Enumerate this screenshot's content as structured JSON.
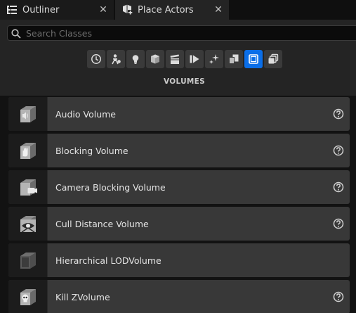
{
  "tabs": [
    {
      "label": "Outliner",
      "icon": "outliner-icon",
      "close": "✕"
    },
    {
      "label": "Place Actors",
      "icon": "place-actors-icon",
      "close": "✕"
    }
  ],
  "search": {
    "placeholder": "Search Classes",
    "value": ""
  },
  "categories": [
    {
      "name": "recently-placed",
      "icon": "clock-icon",
      "active": false
    },
    {
      "name": "basic",
      "icon": "basic-actors-icon",
      "active": false
    },
    {
      "name": "lights",
      "icon": "lightbulb-icon",
      "active": false
    },
    {
      "name": "shapes",
      "icon": "cube-icon",
      "active": false
    },
    {
      "name": "cinematic",
      "icon": "clapper-icon",
      "active": false
    },
    {
      "name": "visual-effects",
      "icon": "play-effects-icon",
      "active": false
    },
    {
      "name": "geometry",
      "icon": "sparkle-icon",
      "active": false
    },
    {
      "name": "volumes-alt",
      "icon": "stacked-cubes-icon",
      "active": false
    },
    {
      "name": "volumes",
      "icon": "volume-icon",
      "active": true
    },
    {
      "name": "all-classes",
      "icon": "all-classes-icon",
      "active": false
    }
  ],
  "section_title": "VOLUMES",
  "items": [
    {
      "label": "Audio Volume",
      "icon": "audio-volume-icon",
      "has_help": true
    },
    {
      "label": "Blocking Volume",
      "icon": "blocking-volume-icon",
      "has_help": true
    },
    {
      "label": "Camera Blocking Volume",
      "icon": "camera-blocking-volume-icon",
      "has_help": true
    },
    {
      "label": "Cull Distance Volume",
      "icon": "cull-distance-volume-icon",
      "has_help": true
    },
    {
      "label": "Hierarchical LODVolume",
      "icon": "hlod-volume-icon",
      "has_help": false
    },
    {
      "label": "Kill ZVolume",
      "icon": "kill-z-volume-icon",
      "has_help": true
    }
  ],
  "colors": {
    "accent": "#0a6ee8",
    "panel": "#242424",
    "row": "#383838"
  }
}
